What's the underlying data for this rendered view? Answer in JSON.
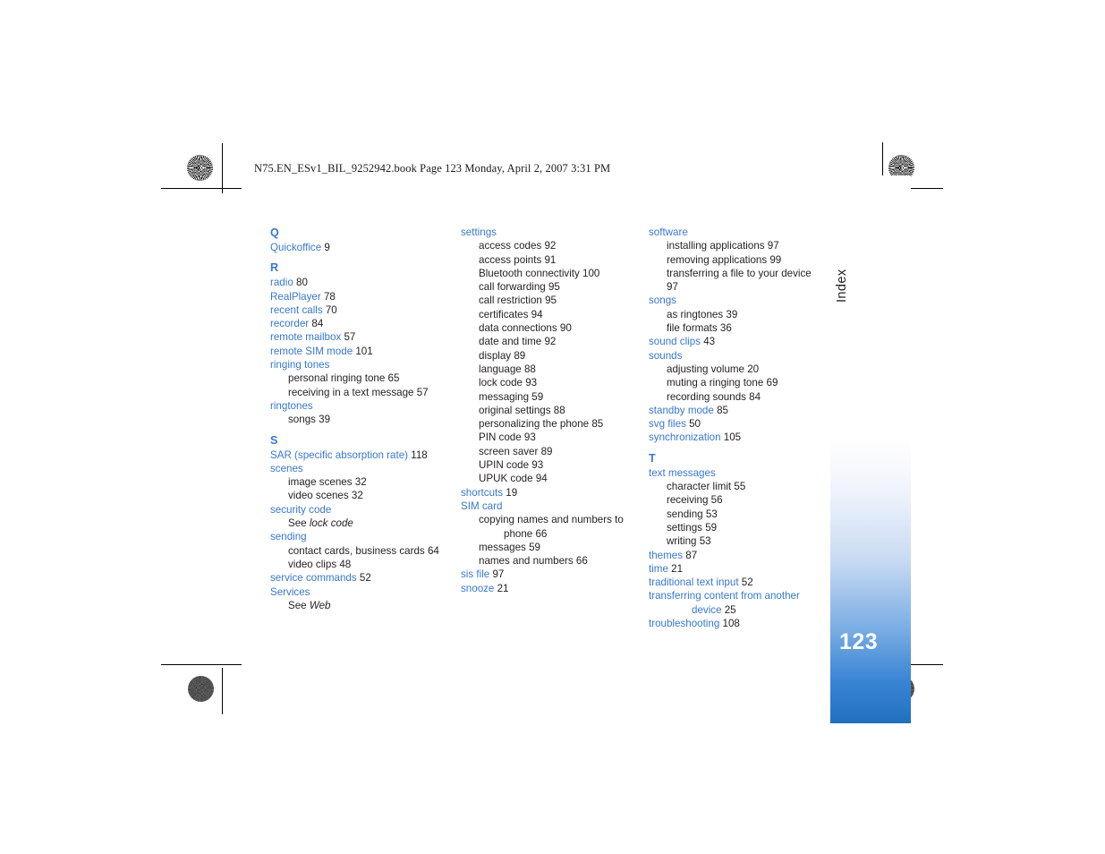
{
  "print_header": "N75.EN_ESv1_BIL_9252942.book  Page 123  Monday, April 2, 2007  3:31 PM",
  "tab": {
    "label": "Index",
    "page_number": "123",
    "gradient_top": "#ffffff",
    "gradient_bottom": "#2070c0",
    "page_number_color": "#ffffff"
  },
  "colors": {
    "entry_blue": "#3878d0",
    "body_text": "#231f20"
  },
  "columns": [
    {
      "id": "column-1",
      "blocks": [
        {
          "type": "letter",
          "text": "Q"
        },
        {
          "type": "entry",
          "term": "Quickoffice",
          "page": "9"
        },
        {
          "type": "letter",
          "text": "R"
        },
        {
          "type": "entry",
          "term": "radio",
          "page": "80"
        },
        {
          "type": "entry",
          "term": "RealPlayer",
          "page": "78"
        },
        {
          "type": "entry",
          "term": "recent calls",
          "page": "70"
        },
        {
          "type": "entry",
          "term": "recorder",
          "page": "84"
        },
        {
          "type": "entry",
          "term": "remote mailbox",
          "page": "57"
        },
        {
          "type": "entry",
          "term": "remote SIM mode",
          "page": "101"
        },
        {
          "type": "entry",
          "term": "ringing tones",
          "page": ""
        },
        {
          "type": "sub",
          "term": "personal ringing tone",
          "page": "65"
        },
        {
          "type": "sub",
          "term": "receiving in a text message",
          "page": "57"
        },
        {
          "type": "entry",
          "term": "ringtones",
          "page": ""
        },
        {
          "type": "sub",
          "term": "songs",
          "page": "39"
        },
        {
          "type": "letter",
          "text": "S"
        },
        {
          "type": "entry",
          "term": "SAR (specific absorption rate)",
          "page": "118"
        },
        {
          "type": "entry",
          "term": "scenes",
          "page": ""
        },
        {
          "type": "sub",
          "term": "image scenes",
          "page": "32"
        },
        {
          "type": "sub",
          "term": "video scenes",
          "page": "32"
        },
        {
          "type": "entry",
          "term": "security code",
          "page": ""
        },
        {
          "type": "see",
          "prefix": "See ",
          "target": "lock code"
        },
        {
          "type": "entry",
          "term": "sending",
          "page": ""
        },
        {
          "type": "sub",
          "term": "contact cards, business cards",
          "page": "64"
        },
        {
          "type": "sub",
          "term": "video clips",
          "page": "48"
        },
        {
          "type": "entry",
          "term": "service commands",
          "page": "52"
        },
        {
          "type": "entry",
          "term": "Services",
          "page": ""
        },
        {
          "type": "see",
          "prefix": "See ",
          "target": "Web"
        }
      ]
    },
    {
      "id": "column-2",
      "blocks": [
        {
          "type": "entry",
          "term": "settings",
          "page": ""
        },
        {
          "type": "sub",
          "term": "access codes",
          "page": "92"
        },
        {
          "type": "sub",
          "term": "access points",
          "page": "91"
        },
        {
          "type": "sub",
          "term": "Bluetooth connectivity",
          "page": "100"
        },
        {
          "type": "sub",
          "term": "call forwarding",
          "page": "95"
        },
        {
          "type": "sub",
          "term": "call restriction",
          "page": "95"
        },
        {
          "type": "sub",
          "term": "certificates",
          "page": "94"
        },
        {
          "type": "sub",
          "term": "data connections",
          "page": "90"
        },
        {
          "type": "sub",
          "term": "date and time",
          "page": "92"
        },
        {
          "type": "sub",
          "term": "display",
          "page": "89"
        },
        {
          "type": "sub",
          "term": "language",
          "page": "88"
        },
        {
          "type": "sub",
          "term": "lock code",
          "page": "93"
        },
        {
          "type": "sub",
          "term": "messaging",
          "page": "59"
        },
        {
          "type": "sub",
          "term": "original settings",
          "page": "88"
        },
        {
          "type": "sub",
          "term": "personalizing the phone",
          "page": "85"
        },
        {
          "type": "sub",
          "term": "PIN code",
          "page": "93"
        },
        {
          "type": "sub",
          "term": "screen saver",
          "page": "89"
        },
        {
          "type": "sub",
          "term": "UPIN code",
          "page": "93"
        },
        {
          "type": "sub",
          "term": "UPUK code",
          "page": "94"
        },
        {
          "type": "entry",
          "term": "shortcuts",
          "page": "19"
        },
        {
          "type": "entry",
          "term": "SIM card",
          "page": ""
        },
        {
          "type": "sub",
          "term": "copying names and numbers to",
          "page": ""
        },
        {
          "type": "sub-wrap",
          "term": "phone",
          "page": "66"
        },
        {
          "type": "sub",
          "term": "messages",
          "page": "59"
        },
        {
          "type": "sub",
          "term": "names and numbers",
          "page": "66"
        },
        {
          "type": "entry",
          "term": "sis file",
          "page": "97"
        },
        {
          "type": "entry",
          "term": "snooze",
          "page": "21"
        }
      ]
    },
    {
      "id": "column-3",
      "blocks": [
        {
          "type": "entry",
          "term": "software",
          "page": ""
        },
        {
          "type": "sub",
          "term": "installing applications",
          "page": "97"
        },
        {
          "type": "sub",
          "term": "removing applications",
          "page": "99"
        },
        {
          "type": "sub",
          "term": "transferring a file to your device",
          "page": "97"
        },
        {
          "type": "entry",
          "term": "songs",
          "page": ""
        },
        {
          "type": "sub",
          "term": "as ringtones",
          "page": "39"
        },
        {
          "type": "sub",
          "term": "file formats",
          "page": "36"
        },
        {
          "type": "entry",
          "term": "sound clips",
          "page": "43"
        },
        {
          "type": "entry",
          "term": "sounds",
          "page": ""
        },
        {
          "type": "sub",
          "term": "adjusting volume",
          "page": "20"
        },
        {
          "type": "sub",
          "term": "muting a ringing tone",
          "page": "69"
        },
        {
          "type": "sub",
          "term": "recording sounds",
          "page": "84"
        },
        {
          "type": "entry",
          "term": "standby mode",
          "page": "85"
        },
        {
          "type": "entry",
          "term": "svg files",
          "page": "50"
        },
        {
          "type": "entry",
          "term": "synchronization",
          "page": "105"
        },
        {
          "type": "letter",
          "text": "T"
        },
        {
          "type": "entry",
          "term": "text messages",
          "page": ""
        },
        {
          "type": "sub",
          "term": "character limit",
          "page": "55"
        },
        {
          "type": "sub",
          "term": "receiving",
          "page": "56"
        },
        {
          "type": "sub",
          "term": "sending",
          "page": "53"
        },
        {
          "type": "sub",
          "term": "settings",
          "page": "59"
        },
        {
          "type": "sub",
          "term": "writing",
          "page": "53"
        },
        {
          "type": "entry",
          "term": "themes",
          "page": "87"
        },
        {
          "type": "entry",
          "term": "time",
          "page": "21"
        },
        {
          "type": "entry",
          "term": "traditional text input",
          "page": "52"
        },
        {
          "type": "entry",
          "term": "transferring content from another",
          "page": ""
        },
        {
          "type": "entry-wrap",
          "term": "device",
          "page": "25"
        },
        {
          "type": "entry",
          "term": "troubleshooting",
          "page": "108"
        }
      ]
    }
  ]
}
